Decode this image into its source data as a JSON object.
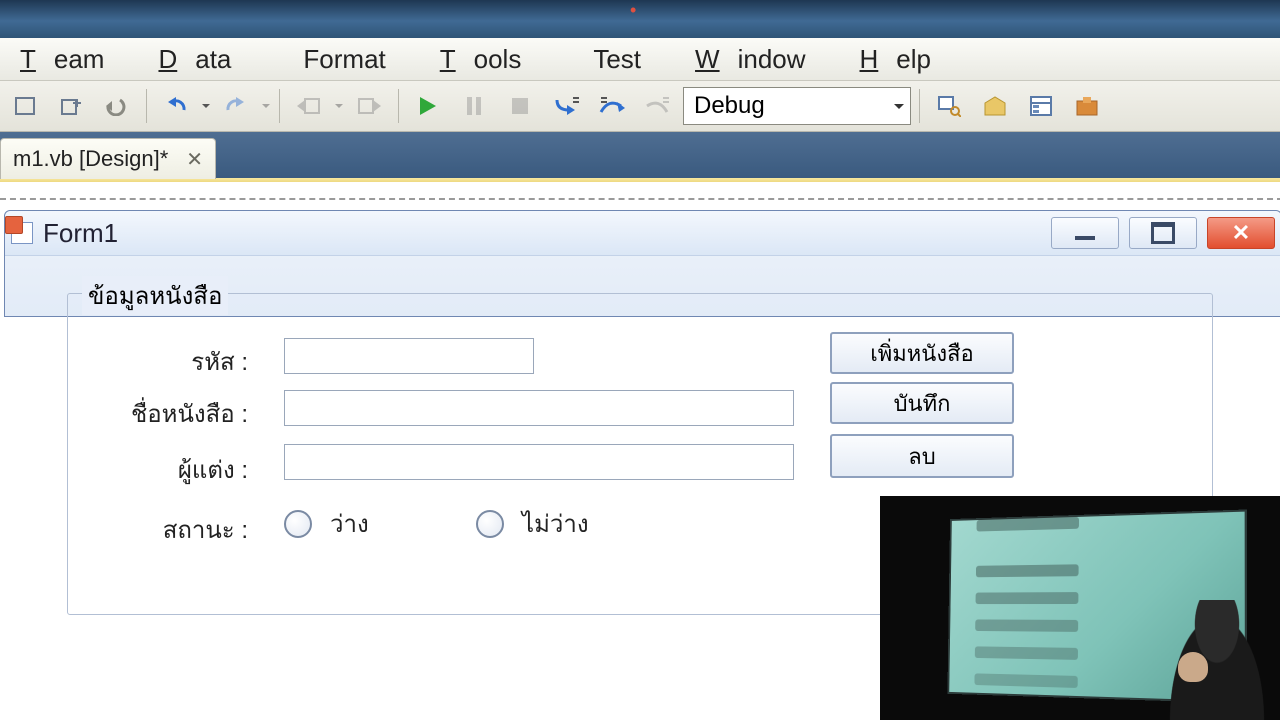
{
  "menu": {
    "team": "Team",
    "data": "Data",
    "format": "Format",
    "tools": "Tools",
    "test": "Test",
    "window": "Window",
    "help": "Help"
  },
  "toolbar": {
    "config": "Debug"
  },
  "tab": {
    "label": "m1.vb [Design]*"
  },
  "form": {
    "title": "Form1",
    "group_legend": "ข้อมูลหนังสือ",
    "labels": {
      "code": "รหัส :",
      "name": "ชื่อหนังสือ :",
      "author": "ผู้แต่ง :",
      "status": "สถานะ :"
    },
    "inputs": {
      "code": "",
      "name": "",
      "author": ""
    },
    "radios": {
      "available": "ว่าง",
      "unavailable": "ไม่ว่าง"
    },
    "buttons": {
      "add": "เพิ่มหนังสือ",
      "save": "บันทึก",
      "delete": "ลบ"
    }
  }
}
